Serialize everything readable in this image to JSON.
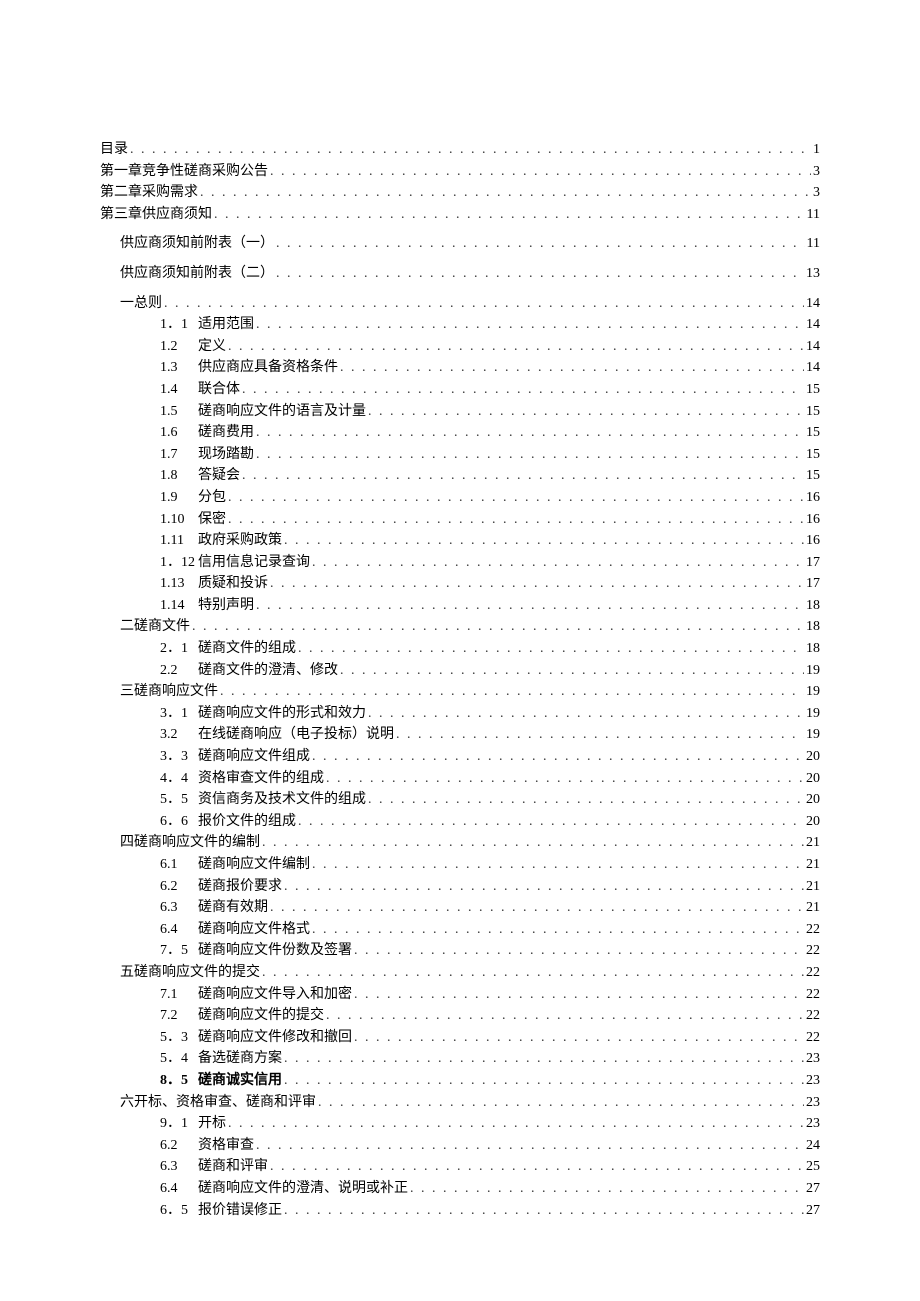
{
  "toc": [
    {
      "indent": 0,
      "num": "",
      "label": "目录",
      "page": "1",
      "bold": false
    },
    {
      "indent": 0,
      "num": "",
      "label": "第一章竞争性磋商采购公告",
      "page": "3",
      "bold": false
    },
    {
      "indent": 0,
      "num": "",
      "label": "第二章采购需求",
      "page": "3",
      "bold": false
    },
    {
      "indent": 0,
      "num": "",
      "label": "第三章供应商须知",
      "page": "11",
      "bold": false,
      "gapAfter": true
    },
    {
      "indent": 1,
      "num": "",
      "label": "供应商须知前附表（一）",
      "page": "11",
      "bold": false,
      "gapAfter": true
    },
    {
      "indent": 1,
      "num": "",
      "label": "供应商须知前附表（二）",
      "page": "13",
      "bold": false,
      "gapAfter": true
    },
    {
      "indent": 1,
      "num": "",
      "label": "一总则",
      "page": "14",
      "bold": false
    },
    {
      "indent": 2,
      "num": "1．1",
      "label": "适用范围",
      "page": "14",
      "bold": false
    },
    {
      "indent": 2,
      "num": "1.2",
      "label": "定义",
      "page": "14",
      "bold": false
    },
    {
      "indent": 2,
      "num": "1.3",
      "label": "供应商应具备资格条件",
      "page": "14",
      "bold": false
    },
    {
      "indent": 2,
      "num": "1.4",
      "label": "联合体",
      "page": "15",
      "bold": false
    },
    {
      "indent": 2,
      "num": "1.5",
      "label": "磋商响应文件的语言及计量",
      "page": "15",
      "bold": false
    },
    {
      "indent": 2,
      "num": "1.6",
      "label": "磋商费用",
      "page": "15",
      "bold": false
    },
    {
      "indent": 2,
      "num": "1.7",
      "label": "现场踏勘",
      "page": "15",
      "bold": false
    },
    {
      "indent": 2,
      "num": "1.8",
      "label": "答疑会",
      "page": "15",
      "bold": false
    },
    {
      "indent": 2,
      "num": "1.9",
      "label": "分包",
      "page": "16",
      "bold": false
    },
    {
      "indent": 2,
      "num": "1.10",
      "label": "保密",
      "page": "16",
      "bold": false
    },
    {
      "indent": 2,
      "num": "1.11",
      "label": "政府采购政策",
      "page": "16",
      "bold": false
    },
    {
      "indent": 2,
      "num": "1．12",
      "label": "信用信息记录查询",
      "page": "17",
      "bold": false
    },
    {
      "indent": 2,
      "num": "1.13",
      "label": "质疑和投诉",
      "page": "17",
      "bold": false
    },
    {
      "indent": 2,
      "num": "1.14",
      "label": "特别声明",
      "page": "18",
      "bold": false
    },
    {
      "indent": 1,
      "num": "",
      "label": "二磋商文件",
      "page": "18",
      "bold": false
    },
    {
      "indent": 2,
      "num": "2．1",
      "label": "磋商文件的组成",
      "page": "18",
      "bold": false
    },
    {
      "indent": 2,
      "num": "2.2",
      "label": "磋商文件的澄清、修改",
      "page": "19",
      "bold": false
    },
    {
      "indent": 1,
      "num": "",
      "label": "三磋商响应文件",
      "page": "19",
      "bold": false
    },
    {
      "indent": 2,
      "num": "3．1",
      "label": "磋商响应文件的形式和效力",
      "page": "19",
      "bold": false
    },
    {
      "indent": 2,
      "num": "3.2",
      "label": "在线磋商响应（电子投标）说明",
      "page": "19",
      "bold": false
    },
    {
      "indent": 2,
      "num": "3．3",
      "label": "磋商响应文件组成",
      "page": "20",
      "bold": false
    },
    {
      "indent": 2,
      "num": "4．4",
      "label": "资格审查文件的组成",
      "page": "20",
      "bold": false
    },
    {
      "indent": 2,
      "num": "5．5",
      "label": "资信商务及技术文件的组成",
      "page": "20",
      "bold": false
    },
    {
      "indent": 2,
      "num": "6．6",
      "label": "报价文件的组成",
      "page": "20",
      "bold": false
    },
    {
      "indent": 1,
      "num": "",
      "label": "四磋商响应文件的编制",
      "page": "21",
      "bold": false
    },
    {
      "indent": 2,
      "num": "6.1",
      "label": "磋商响应文件编制",
      "page": "21",
      "bold": false
    },
    {
      "indent": 2,
      "num": "6.2",
      "label": "磋商报价要求",
      "page": "21",
      "bold": false
    },
    {
      "indent": 2,
      "num": "6.3",
      "label": "磋商有效期",
      "page": "21",
      "bold": false
    },
    {
      "indent": 2,
      "num": "6.4",
      "label": "磋商响应文件格式",
      "page": "22",
      "bold": false
    },
    {
      "indent": 2,
      "num": "7．5",
      "label": "磋商响应文件份数及签署",
      "page": "22",
      "bold": false
    },
    {
      "indent": 1,
      "num": "",
      "label": "五磋商响应文件的提交",
      "page": "22",
      "bold": false
    },
    {
      "indent": 2,
      "num": "7.1",
      "label": "磋商响应文件导入和加密",
      "page": "22",
      "bold": false
    },
    {
      "indent": 2,
      "num": "7.2",
      "label": "磋商响应文件的提交",
      "page": "22",
      "bold": false
    },
    {
      "indent": 2,
      "num": "5．3",
      "label": "磋商响应文件修改和撤回",
      "page": "22",
      "bold": false
    },
    {
      "indent": 2,
      "num": "5．4",
      "label": "备选磋商方案",
      "page": "23",
      "bold": false
    },
    {
      "indent": 2,
      "num": "8．5",
      "label": "磋商诚实信用",
      "page": "23",
      "bold": true
    },
    {
      "indent": 1,
      "num": "",
      "label": "六开标、资格审查、磋商和评审",
      "page": "23",
      "bold": false
    },
    {
      "indent": 2,
      "num": "9．1",
      "label": "开标",
      "page": "23",
      "bold": false
    },
    {
      "indent": 2,
      "num": "6.2",
      "label": "资格审查",
      "page": "24",
      "bold": false
    },
    {
      "indent": 2,
      "num": "6.3",
      "label": "磋商和评审",
      "page": "25",
      "bold": false
    },
    {
      "indent": 2,
      "num": "6.4",
      "label": "磋商响应文件的澄清、说明或补正",
      "page": "27",
      "bold": false
    },
    {
      "indent": 2,
      "num": "6．5",
      "label": "报价错误修正",
      "page": "27",
      "bold": false
    }
  ]
}
